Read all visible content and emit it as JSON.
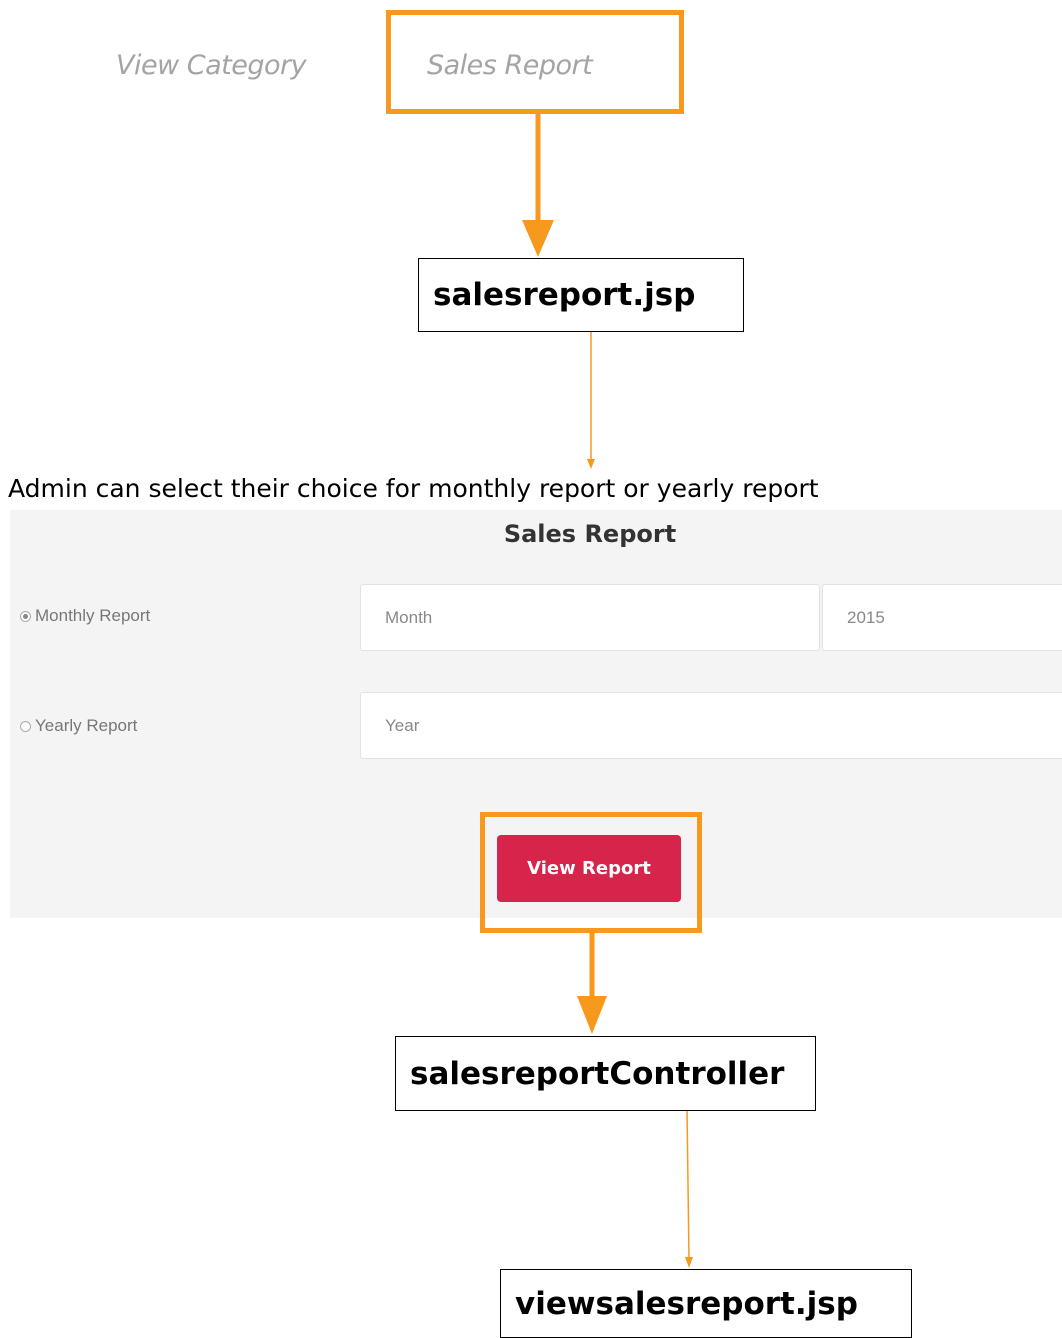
{
  "nav": {
    "view_category": "View Category",
    "sales_report": "Sales Report"
  },
  "flow": {
    "step1": "salesreport.jsp",
    "caption": "Admin can select their choice for monthly report or yearly report",
    "step2": "salesreportController",
    "step3": "viewsalesreport.jsp"
  },
  "form": {
    "title": "Sales Report",
    "monthly_label": "Monthly Report",
    "monthly_selected": true,
    "yearly_label": "Yearly Report",
    "yearly_selected": false,
    "month_value": "Month",
    "month_year_value": "2015",
    "year_value": "Year",
    "view_button": "View Report"
  },
  "colors": {
    "highlight": "#f7991d",
    "button": "#d6244b",
    "panel": "#f4f4f4"
  }
}
